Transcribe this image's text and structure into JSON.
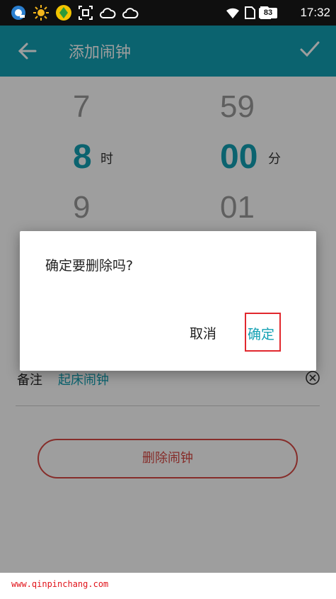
{
  "status_bar": {
    "time": "17:32",
    "battery": "83"
  },
  "app_bar": {
    "title": "添加闹钟"
  },
  "time_picker": {
    "hour_prev": "7",
    "hour_selected": "8",
    "hour_next": "9",
    "hour_unit": "时",
    "minute_prev": "59",
    "minute_selected": "00",
    "minute_next": "01",
    "minute_unit": "分"
  },
  "note": {
    "label": "备注",
    "value": "起床闹钟"
  },
  "delete_button": {
    "label": "删除闹钟"
  },
  "dialog": {
    "message": "确定要删除吗?",
    "cancel_label": "取消",
    "confirm_label": "确定"
  },
  "watermark": "www.qinpinchang.com",
  "colors": {
    "accent": "#13a1b3",
    "danger": "#d84a45",
    "highlight_box": "#e1282e"
  }
}
